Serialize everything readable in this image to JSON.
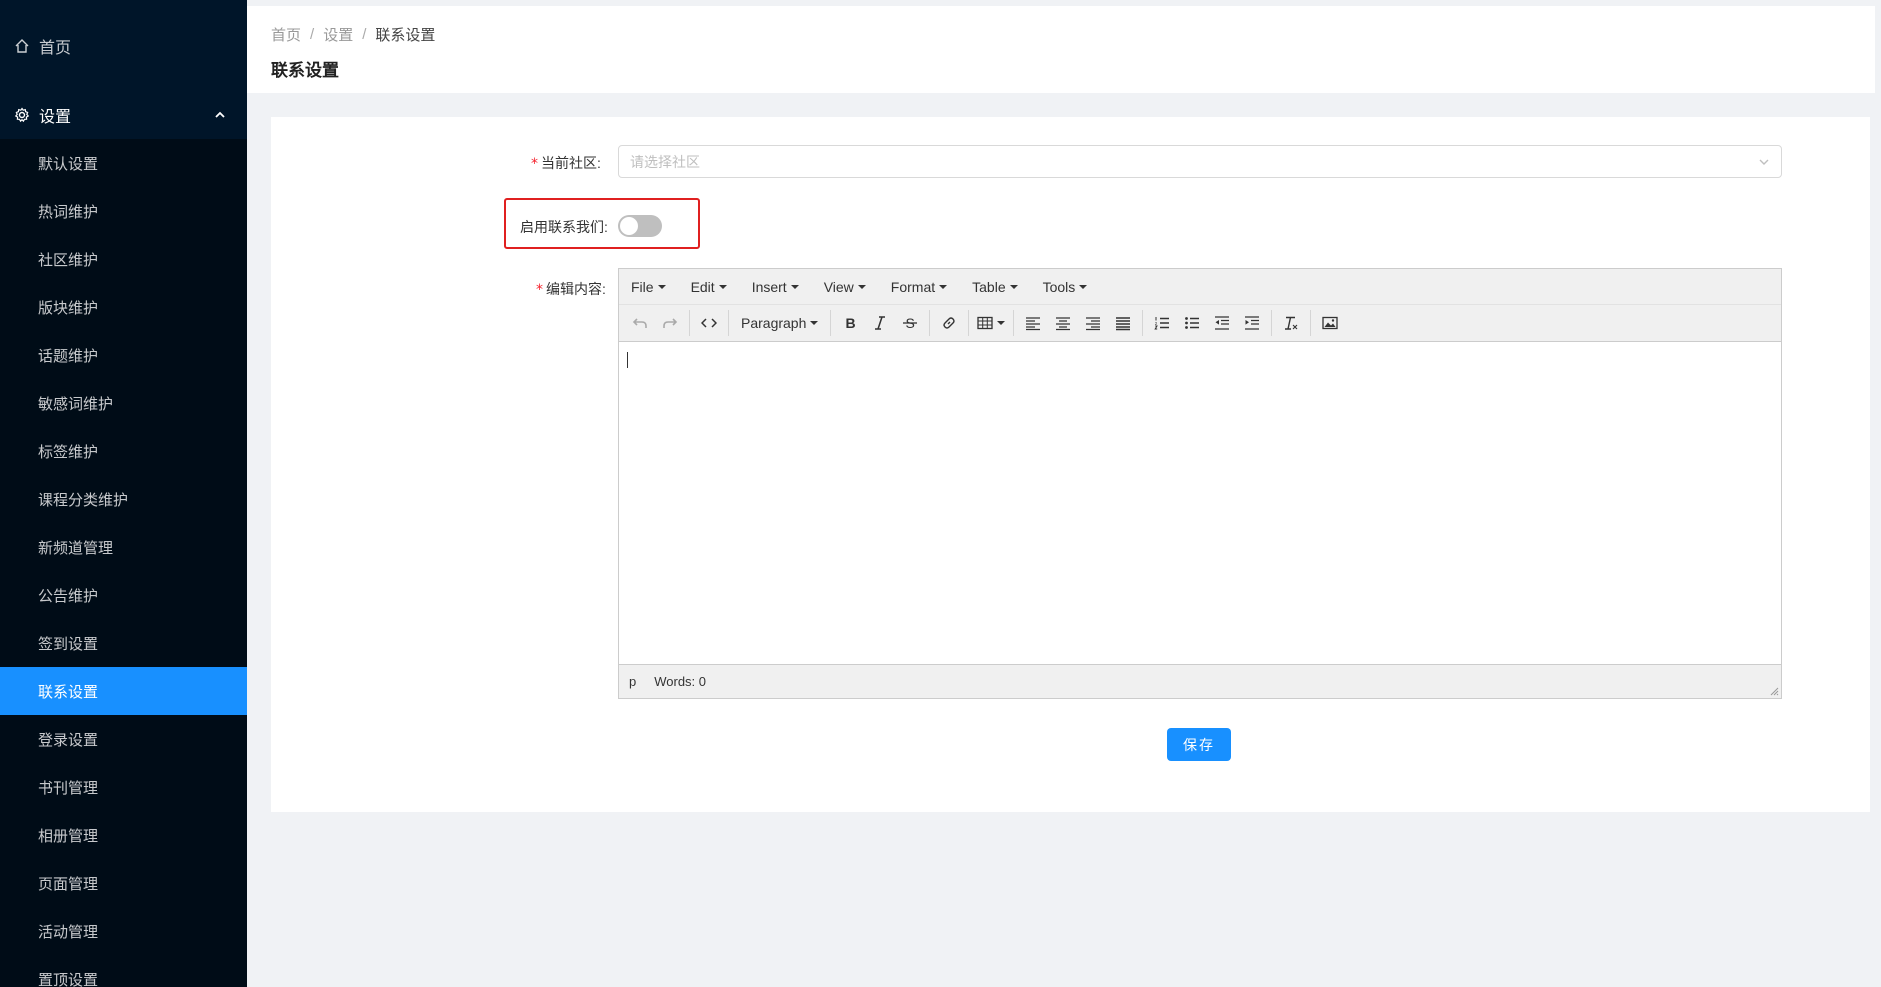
{
  "sidebar": {
    "home_label": "首页",
    "group_label": "设置",
    "items": [
      {
        "label": "默认设置"
      },
      {
        "label": "热词维护"
      },
      {
        "label": "社区维护"
      },
      {
        "label": "版块维护"
      },
      {
        "label": "话题维护"
      },
      {
        "label": "敏感词维护"
      },
      {
        "label": "标签维护"
      },
      {
        "label": "课程分类维护"
      },
      {
        "label": "新频道管理"
      },
      {
        "label": "公告维护"
      },
      {
        "label": "签到设置"
      },
      {
        "label": "联系设置"
      },
      {
        "label": "登录设置"
      },
      {
        "label": "书刊管理"
      },
      {
        "label": "相册管理"
      },
      {
        "label": "页面管理"
      },
      {
        "label": "活动管理"
      },
      {
        "label": "置顶设置"
      }
    ],
    "active_index": 11
  },
  "breadcrumb": {
    "home": "首页",
    "parent": "设置",
    "current": "联系设置",
    "separator": "/"
  },
  "page_title": "联系设置",
  "form": {
    "community_label": "当前社区:",
    "community_placeholder": "请选择社区",
    "enable_label": "启用联系我们:",
    "enable_value": false,
    "content_label": "编辑内容:",
    "required_mark": "*"
  },
  "editor": {
    "menus": [
      "File",
      "Edit",
      "Insert",
      "View",
      "Format",
      "Table",
      "Tools"
    ],
    "block_format": "Paragraph",
    "status_path": "p",
    "word_count": "Words: 0"
  },
  "save_label": "保存",
  "colors": {
    "sidebar_bg": "#001529",
    "active": "#1890ff",
    "highlight_border": "#e02020"
  }
}
